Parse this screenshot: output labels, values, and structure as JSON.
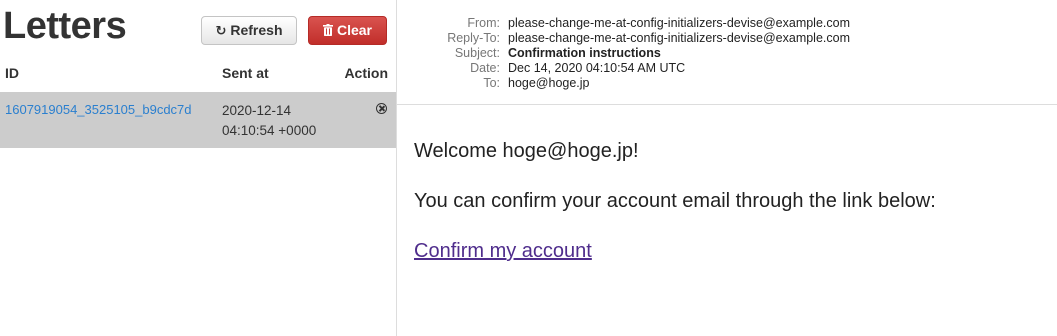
{
  "sidebar": {
    "title": "Letters",
    "refresh_label": "Refresh",
    "clear_label": "Clear",
    "columns": {
      "id": "ID",
      "sent_at": "Sent at",
      "action": "Action"
    },
    "letters": [
      {
        "id": "1607919054_3525105_b9cdc7d",
        "sent_at_date": "2020-12-14",
        "sent_at_time": "04:10:54 +0000",
        "action_icon": "remove-circle-icon"
      }
    ]
  },
  "email": {
    "headers": {
      "from_label": "From:",
      "from_value": "please-change-me-at-config-initializers-devise@example.com",
      "reply_to_label": "Reply-To:",
      "reply_to_value": "please-change-me-at-config-initializers-devise@example.com",
      "subject_label": "Subject:",
      "subject_value": "Confirmation instructions",
      "date_label": "Date:",
      "date_value": "Dec 14, 2020 04:10:54 AM UTC",
      "to_label": "To:",
      "to_value": "hoge@hoge.jp"
    },
    "body": {
      "welcome": "Welcome hoge@hoge.jp!",
      "instructions": "You can confirm your account email through the link below:",
      "link_text": "Confirm my account"
    }
  },
  "colors": {
    "link": "#2a7fcf",
    "visited_link": "#4f2d8c",
    "clear_button": "#d9534f",
    "selected_row": "#cccccc"
  },
  "icons": {
    "refresh": "refresh-icon",
    "clear": "trash-icon",
    "remove": "remove-circle-icon"
  }
}
